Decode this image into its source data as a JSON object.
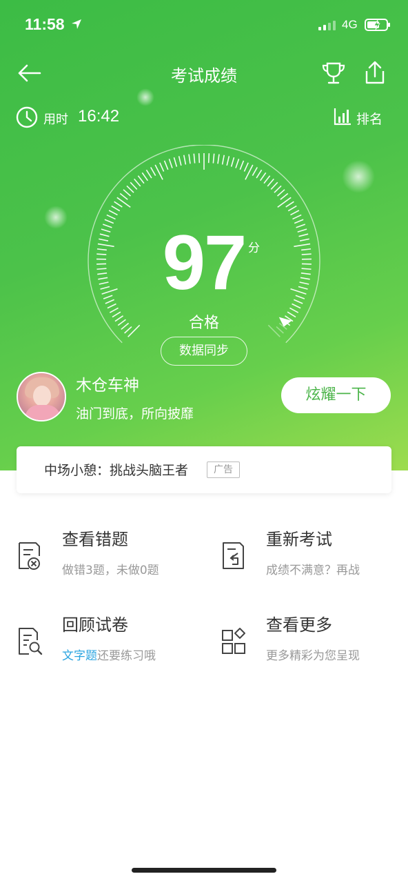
{
  "status_bar": {
    "time": "11:58",
    "network": "4G"
  },
  "nav": {
    "title": "考试成绩"
  },
  "timing": {
    "label": "用时",
    "value": "16:42",
    "rank_label": "排名"
  },
  "result": {
    "score": "97",
    "unit": "分",
    "grade": "合格",
    "sync_label": "数据同步",
    "gauge_fraction": 0.97
  },
  "profile": {
    "name": "木仓车神",
    "motto": "油门到底，所向披靡",
    "show_button": "炫耀一下"
  },
  "ad": {
    "text": "中场小憩：挑战头脑王者",
    "tag": "广告"
  },
  "actions": [
    {
      "title": "查看错题",
      "subtitle": "做错3题，未做0题",
      "icon": "wrong-questions-icon"
    },
    {
      "title": "重新考试",
      "subtitle": "成绩不满意？再战",
      "icon": "retake-exam-icon"
    },
    {
      "title": "回顾试卷",
      "subtitle_highlight": "文字题",
      "subtitle_rest": "还要练习哦",
      "icon": "review-paper-icon"
    },
    {
      "title": "查看更多",
      "subtitle": "更多精彩为您呈现",
      "icon": "more-apps-icon"
    }
  ],
  "colors": {
    "brand_green": "#4bb449",
    "highlight_blue": "#2aa4e0"
  }
}
